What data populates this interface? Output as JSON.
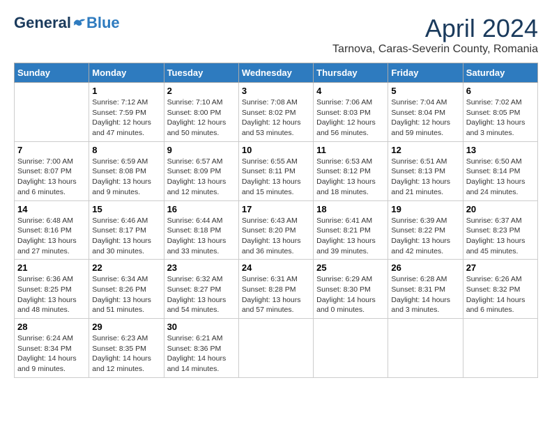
{
  "header": {
    "logo_general": "General",
    "logo_blue": "Blue",
    "month_title": "April 2024",
    "location": "Tarnova, Caras-Severin County, Romania"
  },
  "days_of_week": [
    "Sunday",
    "Monday",
    "Tuesday",
    "Wednesday",
    "Thursday",
    "Friday",
    "Saturday"
  ],
  "weeks": [
    [
      {
        "day": "",
        "info": ""
      },
      {
        "day": "1",
        "info": "Sunrise: 7:12 AM\nSunset: 7:59 PM\nDaylight: 12 hours\nand 47 minutes."
      },
      {
        "day": "2",
        "info": "Sunrise: 7:10 AM\nSunset: 8:00 PM\nDaylight: 12 hours\nand 50 minutes."
      },
      {
        "day": "3",
        "info": "Sunrise: 7:08 AM\nSunset: 8:02 PM\nDaylight: 12 hours\nand 53 minutes."
      },
      {
        "day": "4",
        "info": "Sunrise: 7:06 AM\nSunset: 8:03 PM\nDaylight: 12 hours\nand 56 minutes."
      },
      {
        "day": "5",
        "info": "Sunrise: 7:04 AM\nSunset: 8:04 PM\nDaylight: 12 hours\nand 59 minutes."
      },
      {
        "day": "6",
        "info": "Sunrise: 7:02 AM\nSunset: 8:05 PM\nDaylight: 13 hours\nand 3 minutes."
      }
    ],
    [
      {
        "day": "7",
        "info": "Sunrise: 7:00 AM\nSunset: 8:07 PM\nDaylight: 13 hours\nand 6 minutes."
      },
      {
        "day": "8",
        "info": "Sunrise: 6:59 AM\nSunset: 8:08 PM\nDaylight: 13 hours\nand 9 minutes."
      },
      {
        "day": "9",
        "info": "Sunrise: 6:57 AM\nSunset: 8:09 PM\nDaylight: 13 hours\nand 12 minutes."
      },
      {
        "day": "10",
        "info": "Sunrise: 6:55 AM\nSunset: 8:11 PM\nDaylight: 13 hours\nand 15 minutes."
      },
      {
        "day": "11",
        "info": "Sunrise: 6:53 AM\nSunset: 8:12 PM\nDaylight: 13 hours\nand 18 minutes."
      },
      {
        "day": "12",
        "info": "Sunrise: 6:51 AM\nSunset: 8:13 PM\nDaylight: 13 hours\nand 21 minutes."
      },
      {
        "day": "13",
        "info": "Sunrise: 6:50 AM\nSunset: 8:14 PM\nDaylight: 13 hours\nand 24 minutes."
      }
    ],
    [
      {
        "day": "14",
        "info": "Sunrise: 6:48 AM\nSunset: 8:16 PM\nDaylight: 13 hours\nand 27 minutes."
      },
      {
        "day": "15",
        "info": "Sunrise: 6:46 AM\nSunset: 8:17 PM\nDaylight: 13 hours\nand 30 minutes."
      },
      {
        "day": "16",
        "info": "Sunrise: 6:44 AM\nSunset: 8:18 PM\nDaylight: 13 hours\nand 33 minutes."
      },
      {
        "day": "17",
        "info": "Sunrise: 6:43 AM\nSunset: 8:20 PM\nDaylight: 13 hours\nand 36 minutes."
      },
      {
        "day": "18",
        "info": "Sunrise: 6:41 AM\nSunset: 8:21 PM\nDaylight: 13 hours\nand 39 minutes."
      },
      {
        "day": "19",
        "info": "Sunrise: 6:39 AM\nSunset: 8:22 PM\nDaylight: 13 hours\nand 42 minutes."
      },
      {
        "day": "20",
        "info": "Sunrise: 6:37 AM\nSunset: 8:23 PM\nDaylight: 13 hours\nand 45 minutes."
      }
    ],
    [
      {
        "day": "21",
        "info": "Sunrise: 6:36 AM\nSunset: 8:25 PM\nDaylight: 13 hours\nand 48 minutes."
      },
      {
        "day": "22",
        "info": "Sunrise: 6:34 AM\nSunset: 8:26 PM\nDaylight: 13 hours\nand 51 minutes."
      },
      {
        "day": "23",
        "info": "Sunrise: 6:32 AM\nSunset: 8:27 PM\nDaylight: 13 hours\nand 54 minutes."
      },
      {
        "day": "24",
        "info": "Sunrise: 6:31 AM\nSunset: 8:28 PM\nDaylight: 13 hours\nand 57 minutes."
      },
      {
        "day": "25",
        "info": "Sunrise: 6:29 AM\nSunset: 8:30 PM\nDaylight: 14 hours\nand 0 minutes."
      },
      {
        "day": "26",
        "info": "Sunrise: 6:28 AM\nSunset: 8:31 PM\nDaylight: 14 hours\nand 3 minutes."
      },
      {
        "day": "27",
        "info": "Sunrise: 6:26 AM\nSunset: 8:32 PM\nDaylight: 14 hours\nand 6 minutes."
      }
    ],
    [
      {
        "day": "28",
        "info": "Sunrise: 6:24 AM\nSunset: 8:34 PM\nDaylight: 14 hours\nand 9 minutes."
      },
      {
        "day": "29",
        "info": "Sunrise: 6:23 AM\nSunset: 8:35 PM\nDaylight: 14 hours\nand 12 minutes."
      },
      {
        "day": "30",
        "info": "Sunrise: 6:21 AM\nSunset: 8:36 PM\nDaylight: 14 hours\nand 14 minutes."
      },
      {
        "day": "",
        "info": ""
      },
      {
        "day": "",
        "info": ""
      },
      {
        "day": "",
        "info": ""
      },
      {
        "day": "",
        "info": ""
      }
    ]
  ]
}
